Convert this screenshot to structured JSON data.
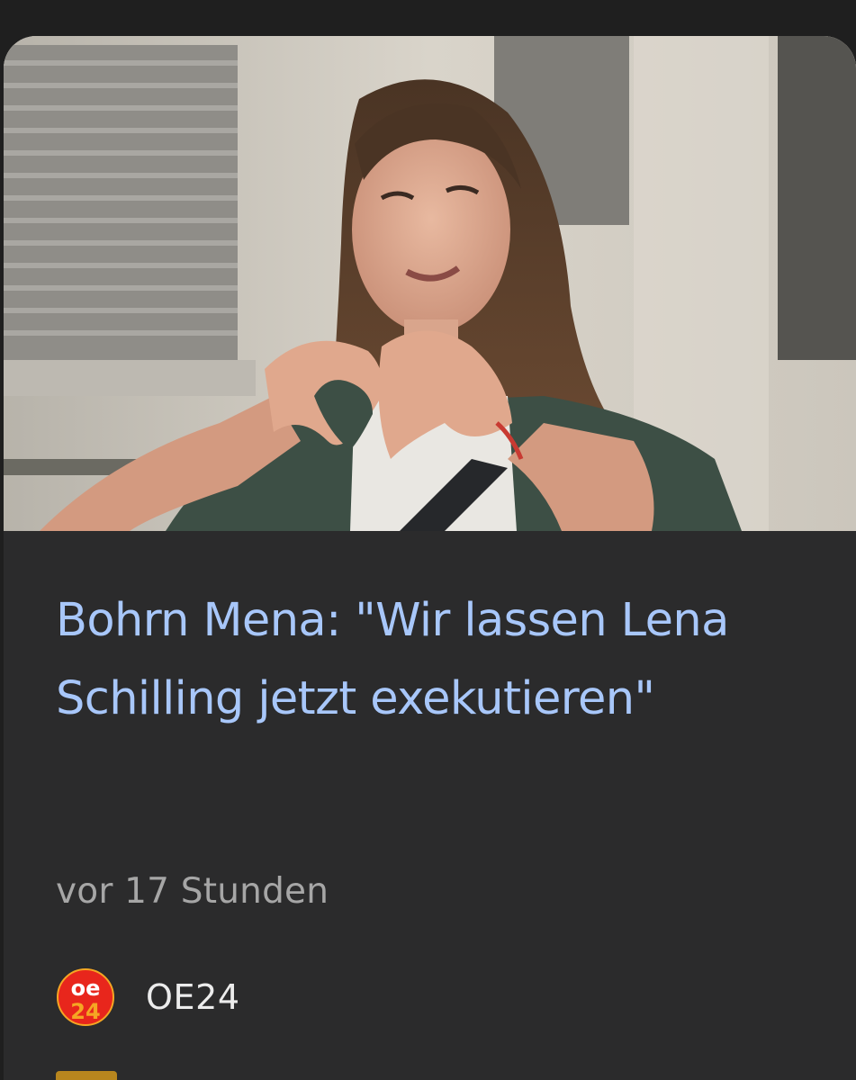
{
  "article": {
    "headline": "Bohrn Mena: \"Wir lassen Lena Schilling jetzt exekutieren\"",
    "published": "vor 17 Stunden",
    "source": {
      "name": "OE24",
      "logo_text": "oe24",
      "logo_colors": [
        "#e8261c",
        "#f5a623"
      ]
    },
    "image_icon": "woman-heart-hands-photo"
  },
  "colors": {
    "background": "#1f1f1f",
    "card": "#2b2b2c",
    "headline": "#a8c7fa",
    "meta": "#a6a6a6",
    "source_text": "#ececec"
  }
}
